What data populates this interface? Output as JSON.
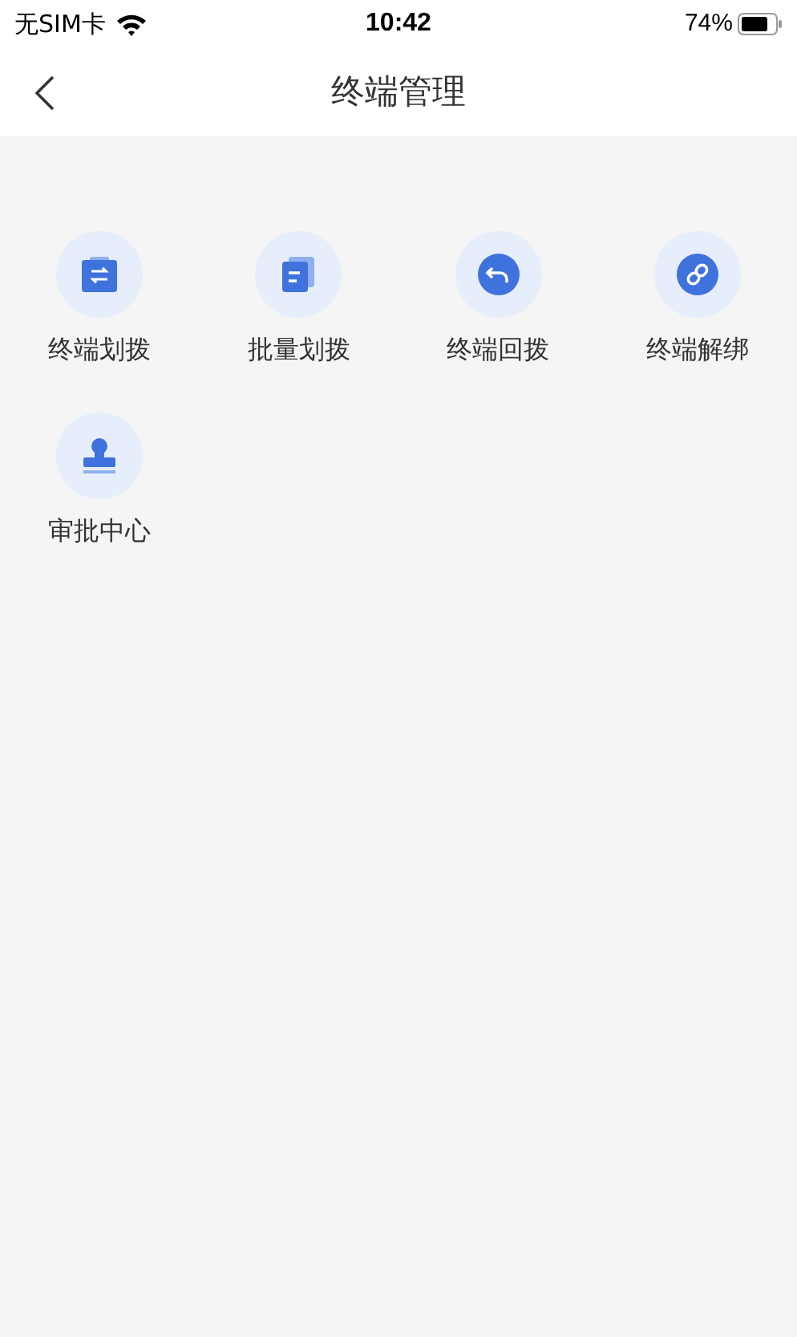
{
  "status_bar": {
    "carrier": "无SIM卡",
    "time": "10:42",
    "battery": "74%"
  },
  "nav": {
    "title": "终端管理"
  },
  "items": [
    {
      "kind": "transfer",
      "label": "终端划拨"
    },
    {
      "kind": "batch",
      "label": "批量划拨"
    },
    {
      "kind": "return",
      "label": "终端回拨"
    },
    {
      "kind": "unbind",
      "label": "终端解绑"
    },
    {
      "kind": "approval",
      "label": "审批中心"
    }
  ]
}
